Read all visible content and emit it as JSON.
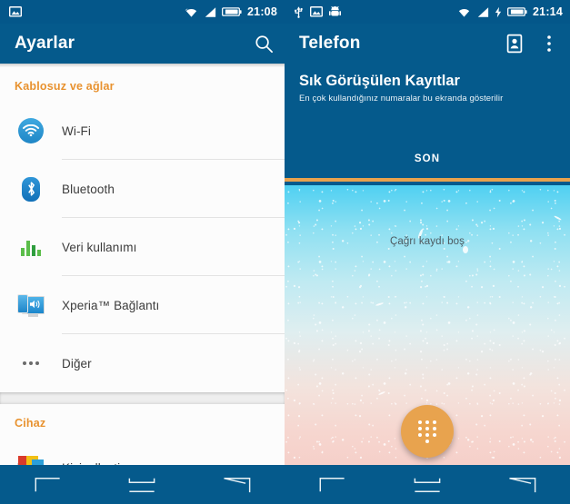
{
  "left": {
    "statusbar": {
      "icons": [
        "image-icon",
        "wifi-icon",
        "signal-icon",
        "battery-icon"
      ],
      "time": "21:08"
    },
    "appbar": {
      "title": "Ayarlar",
      "search_icon": "search-icon"
    },
    "groups": [
      {
        "header": "Kablosuz ve ağlar",
        "items": [
          {
            "label": "Wi-Fi",
            "icon": "wifi-icon"
          },
          {
            "label": "Bluetooth",
            "icon": "bluetooth-icon"
          },
          {
            "label": "Veri kullanımı",
            "icon": "data-usage-icon"
          },
          {
            "label": "Xperia™ Bağlantı",
            "icon": "xperia-connectivity-icon"
          },
          {
            "label": "Diğer",
            "icon": "more-dots-icon"
          }
        ]
      },
      {
        "header": "Cihaz",
        "items": [
          {
            "label": "Kişiselleştirme",
            "icon": "personalization-icon"
          }
        ]
      }
    ]
  },
  "right": {
    "statusbar": {
      "icons": [
        "usb-icon",
        "image-icon",
        "android-icon",
        "wifi-icon",
        "signal-icon",
        "charging-icon",
        "battery-icon"
      ],
      "time": "21:14"
    },
    "appbar": {
      "title": "Telefon",
      "contacts_icon": "contacts-icon",
      "overflow_icon": "overflow-menu-icon"
    },
    "promo": {
      "title": "Sık Görüşülen Kayıtlar",
      "subtitle": "En çok kullandığınız numaralar bu ekranda gösterilir"
    },
    "tabs": [
      {
        "label": "SON",
        "active": true
      }
    ],
    "empty_state": "Çağrı kaydı boş",
    "fab": {
      "icon": "dialpad-icon"
    }
  },
  "navbar": {
    "buttons": [
      {
        "name": "back-button",
        "icon": "back-icon"
      },
      {
        "name": "home-button",
        "icon": "home-icon"
      },
      {
        "name": "recents-button",
        "icon": "recents-icon"
      }
    ]
  },
  "colors": {
    "primary": "#055a8c",
    "status_bar": "#04578a",
    "accent_orange": "#e8922f",
    "fab_orange": "#e8a34e",
    "list_bg": "#fcfcfc"
  }
}
